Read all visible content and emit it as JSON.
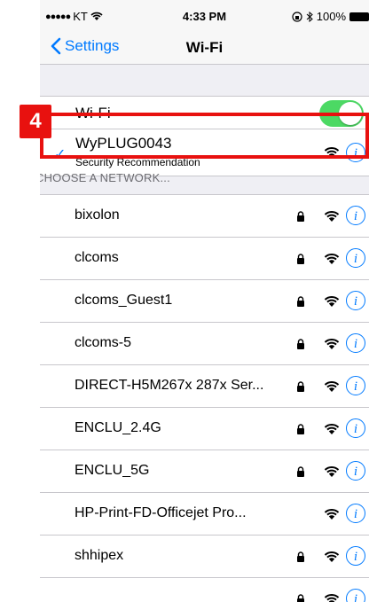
{
  "status_bar": {
    "carrier": "KT",
    "time": "4:33 PM",
    "battery": "100%"
  },
  "nav": {
    "back_label": "Settings",
    "title": "Wi-Fi"
  },
  "wifi_toggle": {
    "label": "Wi-Fi",
    "on": true
  },
  "connected_network": {
    "name": "WyPLUG0043",
    "subtitle": "Security Recommendation"
  },
  "section_header": "CHOOSE A NETWORK...",
  "networks": [
    {
      "name": "bixolon",
      "locked": true
    },
    {
      "name": "clcoms",
      "locked": true
    },
    {
      "name": "clcoms_Guest1",
      "locked": true
    },
    {
      "name": "clcoms-5",
      "locked": true
    },
    {
      "name": "DIRECT-H5M267x 287x Ser...",
      "locked": true
    },
    {
      "name": "ENCLU_2.4G",
      "locked": true
    },
    {
      "name": "ENCLU_5G",
      "locked": true
    },
    {
      "name": "HP-Print-FD-Officejet Pro...",
      "locked": false
    },
    {
      "name": "shhipex",
      "locked": true
    },
    {
      "name": "",
      "locked": true
    }
  ],
  "annotation": {
    "step": "4",
    "color": "#e8110f"
  },
  "colors": {
    "accent": "#007aff",
    "toggle_on": "#4cd964"
  }
}
